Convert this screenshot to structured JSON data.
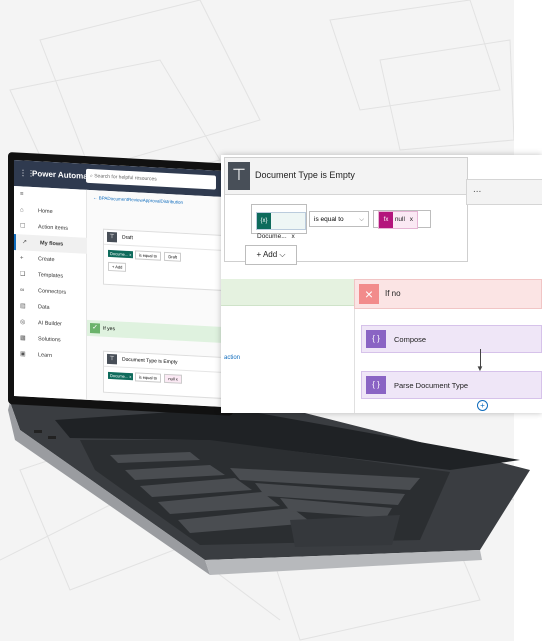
{
  "small_screen": {
    "app_title": "Power Automate",
    "search_placeholder": "Search for helpful resources",
    "breadcrumb": "BPADocumentReviewApprovalDistribution",
    "nav": [
      {
        "label": "Home",
        "icon": "home-icon",
        "glyph": "⌂"
      },
      {
        "label": "Action items",
        "icon": "clipboard-icon",
        "glyph": "☐"
      },
      {
        "label": "My flows",
        "icon": "flow-icon",
        "glyph": "↗"
      },
      {
        "label": "Create",
        "icon": "plus-icon",
        "glyph": "+"
      },
      {
        "label": "Templates",
        "icon": "templates-icon",
        "glyph": "❏"
      },
      {
        "label": "Connectors",
        "icon": "connector-icon",
        "glyph": "∞"
      },
      {
        "label": "Data",
        "icon": "data-icon",
        "glyph": "▤"
      },
      {
        "label": "AI Builder",
        "icon": "ai-icon",
        "glyph": "◎"
      },
      {
        "label": "Solutions",
        "icon": "solutions-icon",
        "glyph": "▦"
      },
      {
        "label": "Learn",
        "icon": "learn-icon",
        "glyph": "▣"
      }
    ],
    "active_nav": "My flows",
    "draft_card": {
      "title": "Draft",
      "token": "Docume... x",
      "operator": "is equal to",
      "value": "Draft",
      "add": "+ Add"
    },
    "if_yes": "If yes",
    "empty_card": {
      "title": "Document Type is Empty",
      "token": "Docume... x",
      "operator": "is equal to",
      "value": "null x"
    }
  },
  "overlay": {
    "condition_title": "Document Type is Empty",
    "menu_label": "...",
    "token_label": "Docume...",
    "token_close": "x",
    "operator": "is equal to",
    "value_label": "null",
    "value_close": "x",
    "add_label": "+ Add",
    "add_chevron": "⌵",
    "action_link": "action",
    "if_no": "If no",
    "compose": "Compose",
    "parse": "Parse Document Type"
  },
  "colors": {
    "topbar": "#2f3a4f",
    "condition_icon": "#484f58",
    "token_teal": "#0e6b5c",
    "token_pink": "#b4157c",
    "if_yes_green": "#e5f2e0",
    "if_no_red": "#fbe4e4",
    "action_purple": "#8a64c4"
  }
}
